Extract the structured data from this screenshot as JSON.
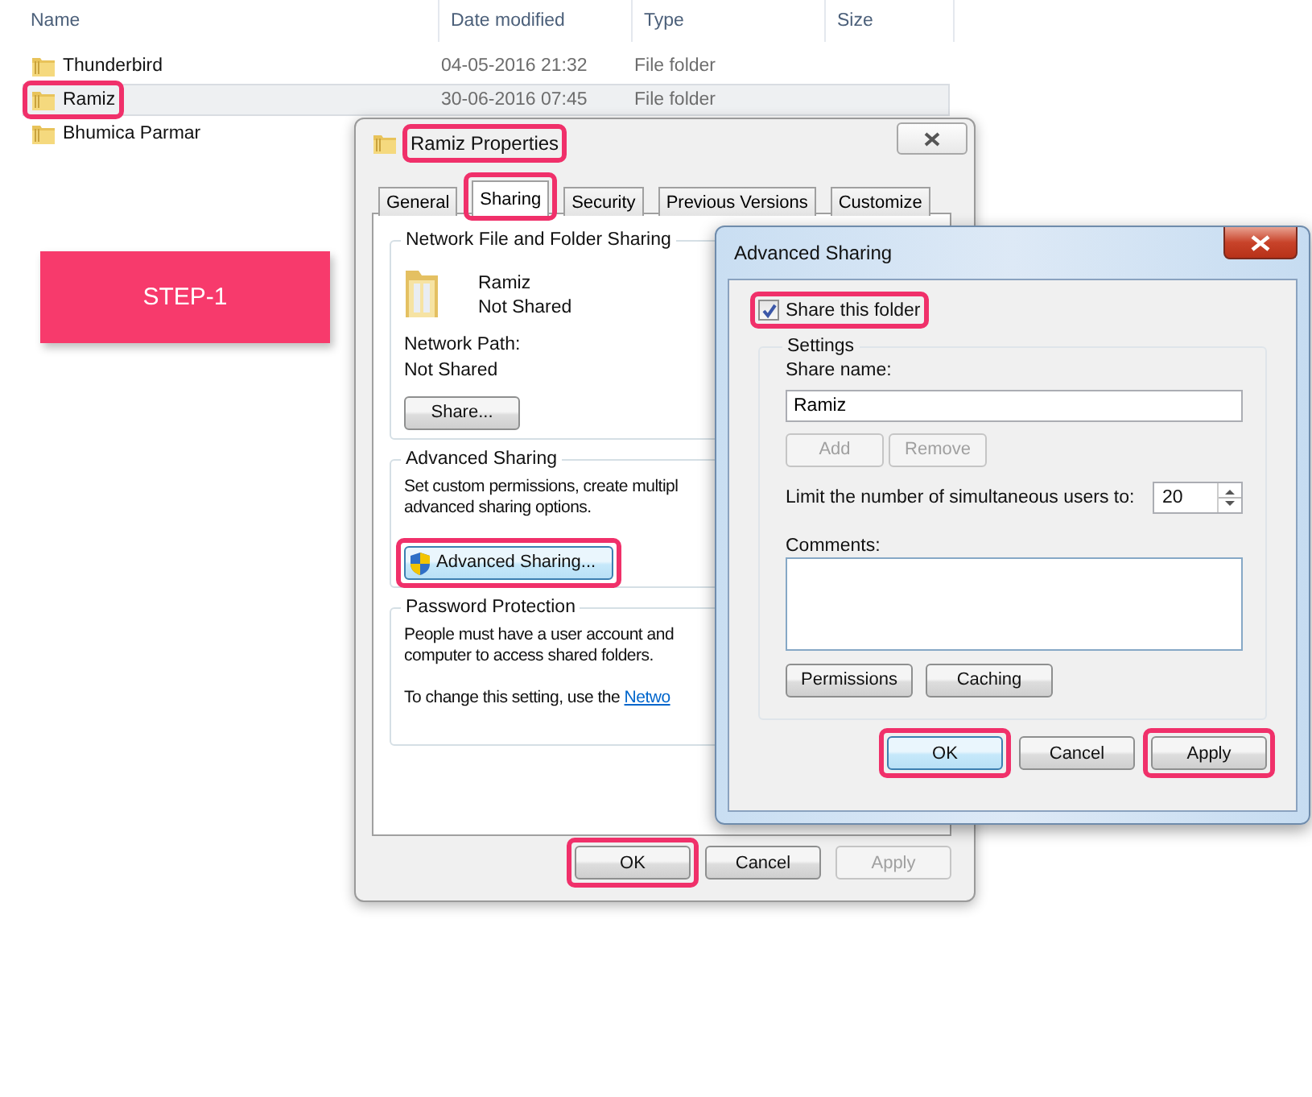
{
  "file_list": {
    "columns": [
      "Name",
      "Date modified",
      "Type",
      "Size"
    ],
    "rows": [
      {
        "name": "Thunderbird",
        "date": "04-05-2016 21:32",
        "type": "File folder",
        "selected": false,
        "highlighted": false
      },
      {
        "name": "Ramiz",
        "date": "30-06-2016 07:45",
        "type": "File folder",
        "selected": true,
        "highlighted": true
      },
      {
        "name": "Bhumica Parmar",
        "selected": false,
        "highlighted": false
      }
    ]
  },
  "step_badge": "STEP-1",
  "properties_dialog": {
    "title": "Ramiz Properties",
    "title_highlighted": true,
    "tabs": [
      {
        "label": "General",
        "selected": false,
        "highlighted": false
      },
      {
        "label": "Sharing",
        "selected": true,
        "highlighted": true
      },
      {
        "label": "Security",
        "selected": false,
        "highlighted": false
      },
      {
        "label": "Previous Versions",
        "selected": false,
        "highlighted": false
      },
      {
        "label": "Customize",
        "selected": false,
        "highlighted": false
      }
    ],
    "network_sharing": {
      "legend": "Network File and Folder Sharing",
      "folder_name": "Ramiz",
      "share_status": "Not Shared",
      "path_label": "Network Path:",
      "path_value": "Not Shared",
      "share_button": "Share..."
    },
    "advanced_sharing": {
      "legend": "Advanced Sharing",
      "description_lines": [
        "Set custom permissions, create multipl",
        "advanced sharing options."
      ],
      "button": {
        "label": "Advanced Sharing...",
        "highlighted": true
      }
    },
    "password_protection": {
      "legend": "Password Protection",
      "lines": [
        "People must have a user account and",
        "computer to access shared folders."
      ],
      "setting_text": "To change this setting, use the",
      "link": "Netwo"
    },
    "buttons": [
      {
        "label": "OK",
        "disabled": false,
        "highlighted": true
      },
      {
        "label": "Cancel",
        "disabled": false,
        "highlighted": false
      },
      {
        "label": "Apply",
        "disabled": true,
        "highlighted": false
      }
    ]
  },
  "advanced_sharing_dialog": {
    "title": "Advanced Sharing",
    "share_checkbox": {
      "label": "Share this folder",
      "checked": true,
      "highlighted": true
    },
    "settings": {
      "legend": "Settings",
      "share_name_label": "Share name:",
      "share_name": "Ramiz",
      "name_buttons": [
        {
          "label": "Add",
          "disabled": true
        },
        {
          "label": "Remove",
          "disabled": true
        }
      ],
      "limit_label": "Limit the number of simultaneous users to:",
      "limit_value": "20",
      "comments_label": "Comments:",
      "buttons": [
        {
          "label": "Permissions",
          "disabled": false
        },
        {
          "label": "Caching",
          "disabled": false
        }
      ]
    },
    "buttons": [
      {
        "label": "OK",
        "disabled": false,
        "highlighted": true,
        "focused": true
      },
      {
        "label": "Cancel",
        "disabled": false,
        "highlighted": false,
        "focused": false
      },
      {
        "label": "Apply",
        "disabled": false,
        "highlighted": true,
        "focused": false
      }
    ]
  }
}
